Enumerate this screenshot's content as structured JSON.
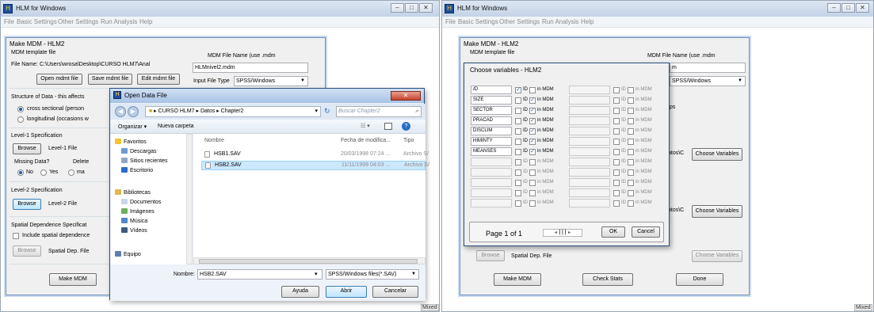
{
  "left_window": {
    "title": "HLM for Windows",
    "menu": [
      "File",
      "Basic Settings",
      "Other Settings",
      "Run Analysis",
      "Help"
    ],
    "mixed": "Mixed",
    "panel": {
      "title": "Make MDM - HLM2",
      "template_label": "MDM template file",
      "mdm_name_label": "MDM File Name (use .mdm",
      "file_name_label": "File Name:",
      "file_name_value": "C:\\Users\\wrosa\\Desktop\\CURSO HLM7\\Anal",
      "mdm_name_value": "HLMnivel2.mdm",
      "open_btn": "Open mdmt file",
      "save_btn": "Save mdmt file",
      "edit_btn": "Edit mdmt file",
      "input_type_label": "Input File Type",
      "input_type_value": "SPSS/Windows",
      "structure_label": "Structure of Data - this affects",
      "cross_sectional": "cross sectional (person",
      "longitudinal": "longitudinal (occasions w",
      "level1_label": "Level-1 Specification",
      "browse1": "Browse",
      "level1_file": "Level-1 File",
      "missing_label": "Missing Data?",
      "delete_label": "Delete",
      "no": "No",
      "yes": "Yes",
      "make_partial": "ma",
      "level2_label": "Level-2 Specification",
      "browse2": "Browse",
      "level2_file": "Level-2 File",
      "spatial_label": "Spatial Dependence Specificat",
      "include_spatial": "Include spatial dependence",
      "browse3": "Browse",
      "spatial_file": "Spatial Dep. File",
      "make_mdm": "Make MDM"
    },
    "dialog": {
      "title": "Open Data File",
      "breadcrumb": [
        "CURSO HLM7",
        "Datos",
        "Chapter2"
      ],
      "search_placeholder": "Buscar Chapter2",
      "organize": "Organizar ▾",
      "new_folder": "Nueva carpeta",
      "nav": {
        "favorites": "Favoritos",
        "downloads": "Descargas",
        "recent": "Sitios recientes",
        "desktop": "Escritorio",
        "libraries": "Bibliotecas",
        "documents": "Documentos",
        "images": "Imágenes",
        "music": "Música",
        "videos": "Vídeos",
        "computer": "Equipo"
      },
      "columns": [
        "Nombre",
        "Fecha de modifica...",
        "Tipo"
      ],
      "files": [
        {
          "name": "HSB1.SAV",
          "date": "20/03/1998 07:24 ...",
          "type": "Archivo S/"
        },
        {
          "name": "HSB2.SAV",
          "date": "11/11/1999 04:03 ...",
          "type": "Archivo S/"
        }
      ],
      "filename_label": "Nombre:",
      "filename_value": "HSB2.SAV",
      "filter_value": "SPSS/Windows files(*.SAV)",
      "help": "Ayuda",
      "open": "Abrir",
      "cancel": "Cancelar"
    }
  },
  "right_window": {
    "title": "HLM for Windows",
    "menu": [
      "File",
      "Basic Settings",
      "Other Settings",
      "Run Analysis",
      "Help"
    ],
    "mixed": "Mixed",
    "panel": {
      "title": "Make MDM - HLM2",
      "template_label": "MDM template file",
      "mdm_name_label": "MDM File Name (use .mdm",
      "name_partial": "m",
      "input_type_value": "SPSS/Windows",
      "ps_partial": "ps",
      "path1_partial": "atos\\C",
      "choose1": "Choose Variables",
      "path2_partial": "atos\\C",
      "choose2": "Choose Variables",
      "browse": "Browse",
      "spatial_file": "Spatial Dep. File",
      "choose3": "Choose Variables",
      "make_mdm": "Make MDM",
      "check_stats": "Check Stats",
      "done": "Done"
    },
    "dialog": {
      "title": "Choose variables - HLM2",
      "id_label": "ID",
      "in_mdm_label": "in MDM",
      "variables": [
        {
          "name": "ID",
          "id": true,
          "in_mdm": false
        },
        {
          "name": "SIZE",
          "id": false,
          "in_mdm": true
        },
        {
          "name": "SECTOR",
          "id": false,
          "in_mdm": true
        },
        {
          "name": "PRACAD",
          "id": false,
          "in_mdm": true
        },
        {
          "name": "DISCLIM",
          "id": false,
          "in_mdm": true
        },
        {
          "name": "HIMINTY",
          "id": false,
          "in_mdm": true
        },
        {
          "name": "MEANSES",
          "id": false,
          "in_mdm": true
        }
      ],
      "empty_rows": 5,
      "page": "Page 1 of 1",
      "ok": "OK",
      "cancel": "Cancel"
    }
  }
}
